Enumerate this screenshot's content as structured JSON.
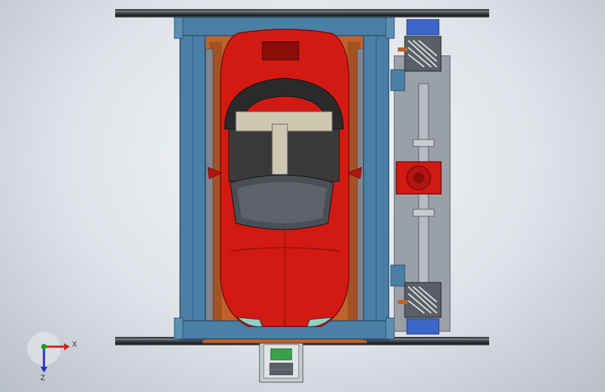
{
  "viewport": {
    "background_colors": [
      "#f4f5f7",
      "#b9bfc8"
    ]
  },
  "model": {
    "colors": {
      "frame_blue": "#4a7fa6",
      "frame_dark": "#2c4f6e",
      "rail": "#3a3d42",
      "car_red": "#d21a12",
      "car_dark": "#7a0c08",
      "copper": "#c0622e",
      "grey_panel": "#9aa0a8",
      "motor_blue": "#3e66c8",
      "green_board": "#3aa34a"
    }
  },
  "triad": {
    "x_label": "X",
    "z_label": "Z",
    "x_color": "#cc2020",
    "y_color": "#22a022",
    "z_color": "#2030c0"
  }
}
